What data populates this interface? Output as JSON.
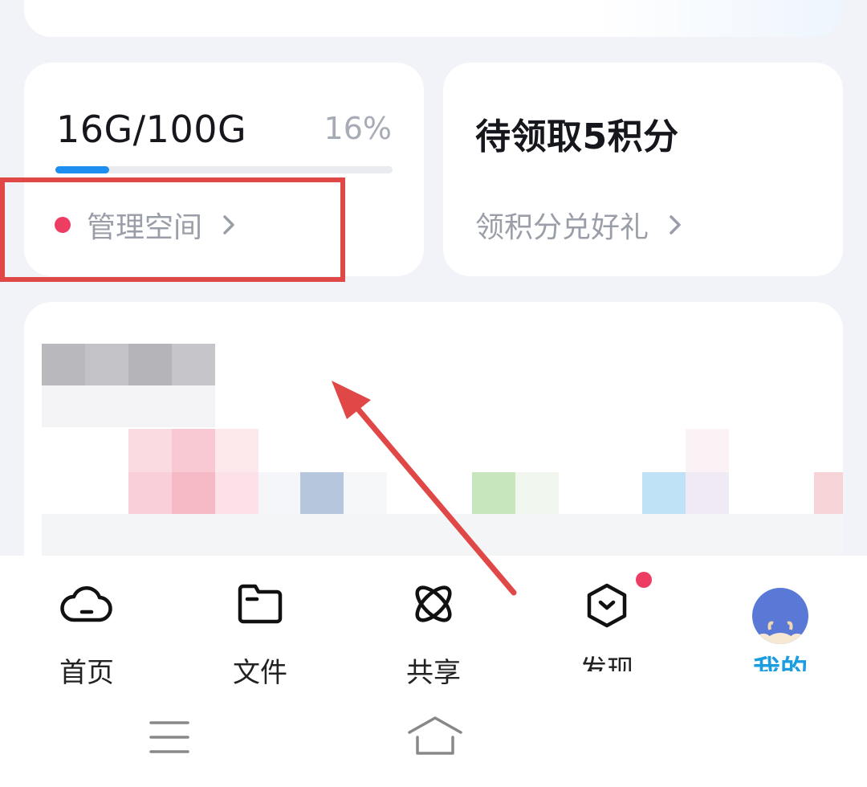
{
  "storage": {
    "amount": "16G/100G",
    "percent": "16%",
    "usage_fraction": 0.16,
    "manage_label": "管理空间"
  },
  "points": {
    "title": "待领取5积分",
    "link_label": "领积分兑好礼"
  },
  "tabs": [
    {
      "label": "首页",
      "icon": "cloud-icon"
    },
    {
      "label": "文件",
      "icon": "folder-icon"
    },
    {
      "label": "共享",
      "icon": "share-atom-icon"
    },
    {
      "label": "发现",
      "icon": "discover-cube-icon",
      "has_badge": true
    },
    {
      "label": "我的",
      "icon": "avatar-cow",
      "active": true
    }
  ],
  "colors": {
    "accent": "#1e8ff0",
    "badge": "#ee3d63",
    "highlight": "#e04848",
    "active_tab": "#1c9de0"
  }
}
